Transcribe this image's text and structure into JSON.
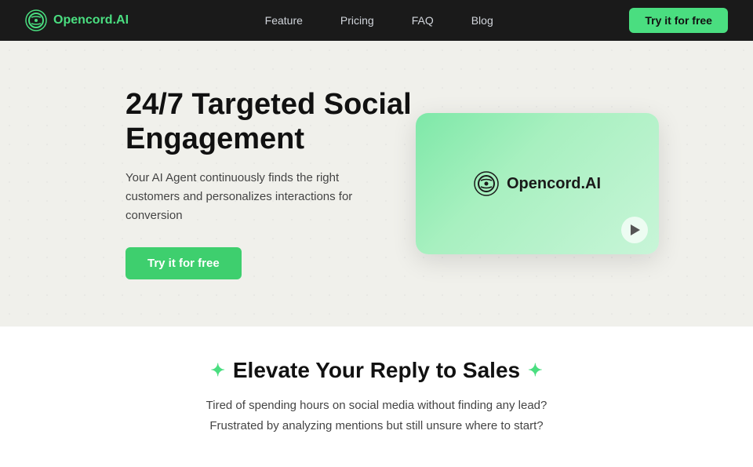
{
  "nav": {
    "logo_text": "Opencord.AI",
    "links": [
      "Feature",
      "Pricing",
      "FAQ",
      "Blog"
    ],
    "cta_label": "Try it for free"
  },
  "hero": {
    "title_line1": "24/7 Targeted Social",
    "title_line2": "Engagement",
    "subtitle": "Your AI Agent continuously finds the right customers and personalizes interactions for conversion",
    "cta_label": "Try it for free",
    "video_logo_text": "Opencord.AI"
  },
  "lower": {
    "section_title": "Elevate Your Reply to Sales",
    "body_line1": "Tired of spending hours on social media without finding any lead?",
    "body_line2": "Frustrated by analyzing mentions but still unsure where to start?"
  }
}
